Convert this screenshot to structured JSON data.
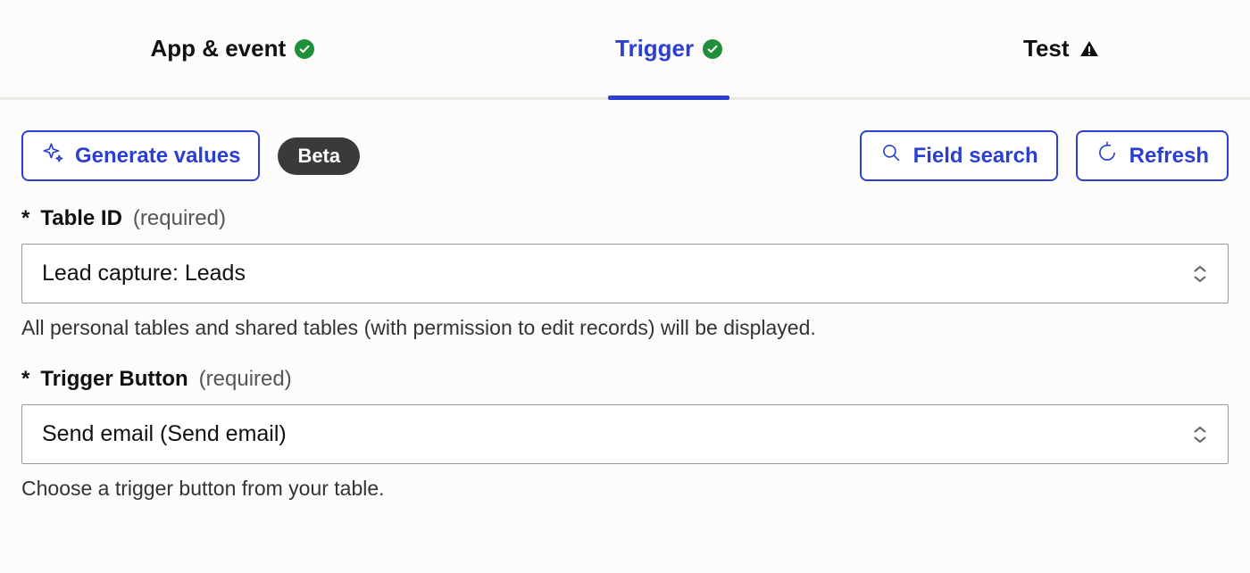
{
  "tabs": {
    "app_event": {
      "label": "App & event",
      "status": "ok"
    },
    "trigger": {
      "label": "Trigger",
      "status": "ok",
      "active": true
    },
    "test": {
      "label": "Test",
      "status": "warn"
    }
  },
  "toolbar": {
    "generate_values_label": "Generate values",
    "beta_badge": "Beta",
    "field_search_label": "Field search",
    "refresh_label": "Refresh"
  },
  "fields": {
    "table_id": {
      "star": "*",
      "label": "Table ID",
      "required_text": "(required)",
      "value": "Lead capture: Leads",
      "help": "All personal tables and shared tables (with permission to edit records) will be displayed."
    },
    "trigger_button": {
      "star": "*",
      "label": "Trigger Button",
      "required_text": "(required)",
      "value": "Send email (Send email)",
      "help": "Choose a trigger button from your table."
    }
  }
}
